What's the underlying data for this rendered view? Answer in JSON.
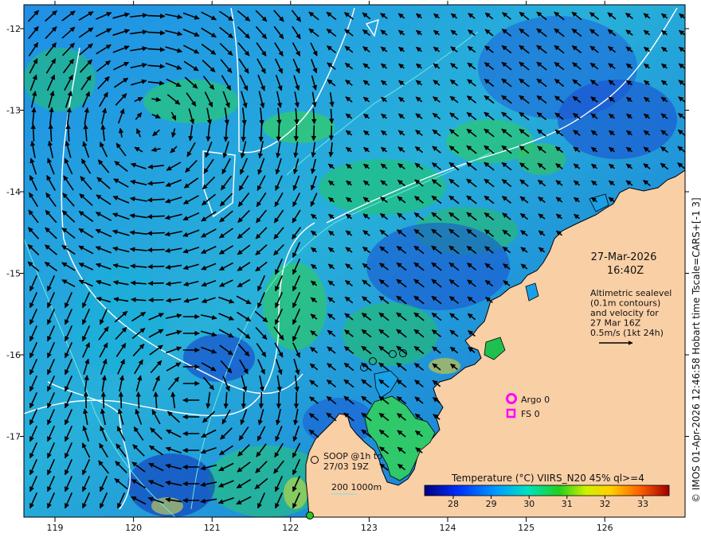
{
  "map": {
    "lon_ticks": [
      "119",
      "120",
      "121",
      "122",
      "123",
      "124",
      "125",
      "126"
    ],
    "lat_ticks": [
      "-12",
      "-13",
      "-14",
      "-15",
      "-16",
      "-17"
    ],
    "date": "27-Mar-2026",
    "time": "16:40Z",
    "altimetry_note": [
      "Altimetric sealevel",
      "(0.1m contours)",
      "and velocity for",
      "27 Mar 16Z",
      "0.5m/s (1kt 24h)"
    ],
    "argo_label": "Argo 0",
    "fs_label": "FS 0",
    "soop_label": [
      "SOOP @1h to",
      "27/03 19Z"
    ],
    "depth_label": "200  1000m",
    "colorbar_title": "Temperature (°C) VIIRS_N20 45% ql>=4",
    "colorbar_ticks": [
      "28",
      "29",
      "30",
      "31",
      "32",
      "33"
    ],
    "side_credit": "© IMOS 01-Apr-2026 12:46:58 Hobart time Tscale=CARS+[-1 3]",
    "colors": {
      "land": "#f9cfa6",
      "argo": "#ff00ff",
      "contour": "#ffffff",
      "isobath": "#6fe8e0"
    }
  }
}
